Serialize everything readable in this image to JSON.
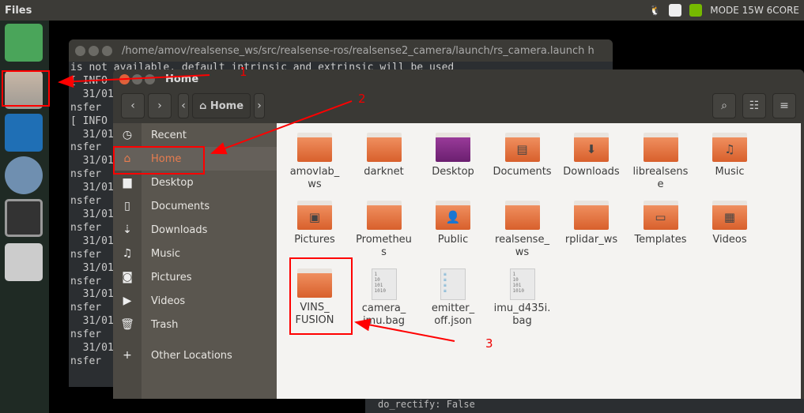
{
  "topbar": {
    "app_name": "Files",
    "mode": "MODE 15W 6CORE"
  },
  "launcher": {
    "items": [
      "ubuntu",
      "files",
      "vscode",
      "chromium",
      "terminal",
      "drive"
    ]
  },
  "terminal": {
    "title": "/home/amov/realsense_ws/src/realsense-ros/realsense2_camera/launch/rs_camera.launch h",
    "lines": [
      "is not available, default intrinsic and extrinsic will be used",
      "[ INFO",
      "  31/01",
      "nsfer",
      "[ INFO",
      "  31/01",
      "nsfer",
      "  31/01",
      "nsfer",
      "  31/01",
      "nsfer",
      "  31/01",
      "nsfer",
      "  31/01",
      "nsfer",
      "  31/01",
      "nsfer",
      "  31/01",
      "nsfer",
      "  31/01",
      "nsfer",
      "  31/01",
      "nsfer"
    ],
    "bottom_line": "do_rectify: False"
  },
  "files": {
    "title": "Home",
    "path_label": "Home",
    "sidebar": [
      {
        "label": "Recent",
        "icon": "clock-icon",
        "glyph": "◷"
      },
      {
        "label": "Home",
        "icon": "home-icon",
        "glyph": "⌂",
        "active": true
      },
      {
        "label": "Desktop",
        "icon": "folder-icon",
        "glyph": "▆"
      },
      {
        "label": "Documents",
        "icon": "document-icon",
        "glyph": "▯"
      },
      {
        "label": "Downloads",
        "icon": "download-icon",
        "glyph": "⇣"
      },
      {
        "label": "Music",
        "icon": "music-icon",
        "glyph": "♫"
      },
      {
        "label": "Pictures",
        "icon": "camera-icon",
        "glyph": "◙"
      },
      {
        "label": "Videos",
        "icon": "video-icon",
        "glyph": "▶"
      },
      {
        "label": "Trash",
        "icon": "trash-icon",
        "glyph": "🗑"
      },
      {
        "label": "Other Locations",
        "icon": "plus-icon",
        "glyph": "+"
      }
    ],
    "items": [
      {
        "name": "amovlab_\nws",
        "type": "folder"
      },
      {
        "name": "darknet",
        "type": "folder"
      },
      {
        "name": "Desktop",
        "type": "desktop"
      },
      {
        "name": "Documents",
        "type": "folder",
        "glyph": "▤"
      },
      {
        "name": "Downloads",
        "type": "folder",
        "glyph": "⬇"
      },
      {
        "name": "librealsens\ne",
        "type": "folder"
      },
      {
        "name": "Music",
        "type": "folder",
        "glyph": "♫"
      },
      {
        "name": "Pictures",
        "type": "folder",
        "glyph": "▣"
      },
      {
        "name": "Prometheu\ns",
        "type": "folder"
      },
      {
        "name": "Public",
        "type": "folder",
        "glyph": "👤"
      },
      {
        "name": "realsense_\nws",
        "type": "folder"
      },
      {
        "name": "rplidar_ws",
        "type": "folder"
      },
      {
        "name": "Templates",
        "type": "folder",
        "glyph": "▭"
      },
      {
        "name": "Videos",
        "type": "folder",
        "glyph": "▦"
      },
      {
        "name": "VINS_\nFUSION",
        "type": "folder"
      },
      {
        "name": "camera_\nimu.bag",
        "type": "binary"
      },
      {
        "name": "emitter_\noff.json",
        "type": "text"
      },
      {
        "name": "imu_d435i.\nbag",
        "type": "binary"
      }
    ]
  },
  "annotations": {
    "labels": [
      "1",
      "2",
      "3"
    ],
    "color": "#ff0000"
  }
}
